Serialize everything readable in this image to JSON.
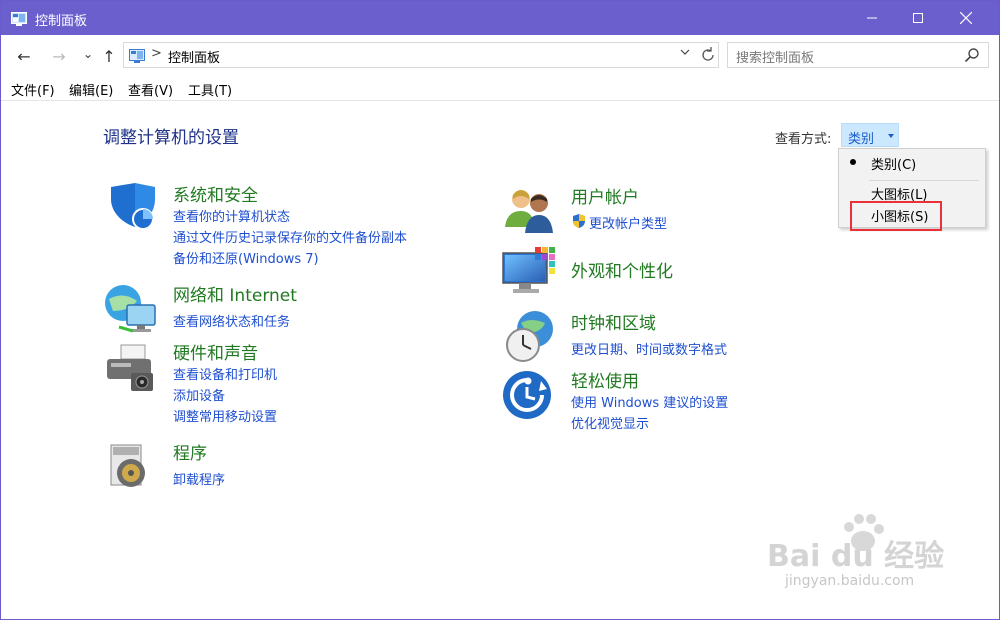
{
  "window": {
    "title": "控制面板",
    "accent": "#6b5fce"
  },
  "nav": {
    "back_glyph": "←",
    "forward_glyph": "→",
    "recent_glyph": "⌄",
    "up_glyph": "↑",
    "address_sep": ">",
    "address_path": "控制面板",
    "search_placeholder": "搜索控制面板"
  },
  "menu": [
    "文件(F)",
    "编辑(E)",
    "查看(V)",
    "工具(T)"
  ],
  "main": {
    "heading": "调整计算机的设置",
    "view_by_label": "查看方式:",
    "view_by_value": "类别"
  },
  "dropdown": {
    "items": [
      "类别(C)",
      "大图标(L)",
      "小图标(S)"
    ],
    "selected": "类别(C)"
  },
  "categories": [
    {
      "title": "系统和安全",
      "icon": "shield-icon",
      "links": [
        "查看你的计算机状态",
        "通过文件历史记录保存你的文件备份副本",
        "备份和还原(Windows 7)"
      ]
    },
    {
      "title": "网络和 Internet",
      "icon": "network-icon",
      "links": [
        "查看网络状态和任务"
      ]
    },
    {
      "title": "硬件和声音",
      "icon": "printer-icon",
      "links": [
        "查看设备和打印机",
        "添加设备",
        "调整常用移动设置"
      ]
    },
    {
      "title": "程序",
      "icon": "programs-icon",
      "links": [
        "卸载程序"
      ]
    },
    {
      "title": "用户帐户",
      "icon": "users-icon",
      "links": [
        "更改帐户类型"
      ]
    },
    {
      "title": "外观和个性化",
      "icon": "monitor-icon",
      "links": []
    },
    {
      "title": "时钟和区域",
      "icon": "clock-icon",
      "links": [
        "更改日期、时间或数字格式"
      ]
    },
    {
      "title": "轻松使用",
      "icon": "ease-of-access-icon",
      "links": [
        "使用 Windows 建议的设置",
        "优化视觉显示"
      ]
    }
  ],
  "watermark": {
    "brand": "Bai du 经验",
    "url": "jingyan.baidu.com"
  }
}
